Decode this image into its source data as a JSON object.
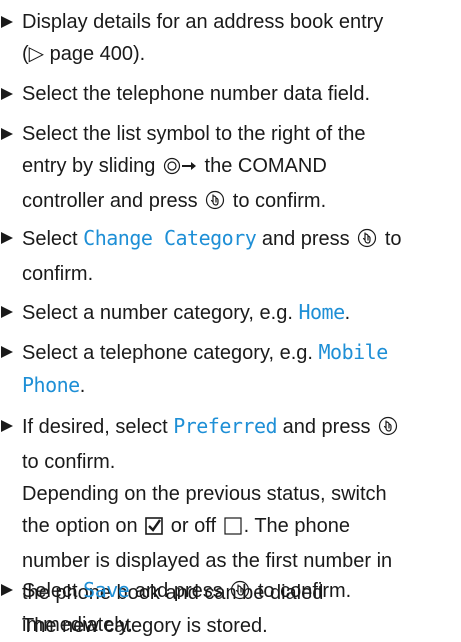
{
  "steps": [
    {
      "t1": "Display details for an address book entry",
      "t2": "(▷ page 400)."
    },
    {
      "t1": "Select the telephone number data field."
    },
    {
      "t1": "Select the list symbol to the right of the",
      "t2a": "entry by sliding",
      "t2b": "the COMAND",
      "t3a": "controller and press",
      "t3b": "to confirm."
    },
    {
      "t1a": "Select",
      "hl": "Change Category",
      "t1b": "and press",
      "t1c": "to",
      "t2": "confirm."
    },
    {
      "t1a": "Select a number category, e.g.",
      "hl": "Home",
      "t1b": "."
    },
    {
      "t1": "Select a telephone category, e.g.",
      "hl1": "Mobile",
      "hl2": "Phone",
      "t2b": "."
    },
    {
      "t1a": "If desired, select",
      "hl": "Preferred",
      "t1b": "and press",
      "t2": "to confirm.",
      "r1": "Depending on the previous status, switch",
      "r2a": "the option on",
      "r2b": "or off",
      "r2c": ". The phone",
      "r3": "number is displayed as the first number in",
      "r4": "the phone book and can be dialed",
      "r5": "immediately."
    },
    {
      "t1a": "Select",
      "hl": "Save",
      "t1b": "and press",
      "t1c": "to confirm.",
      "r1": "The new category is stored."
    }
  ]
}
